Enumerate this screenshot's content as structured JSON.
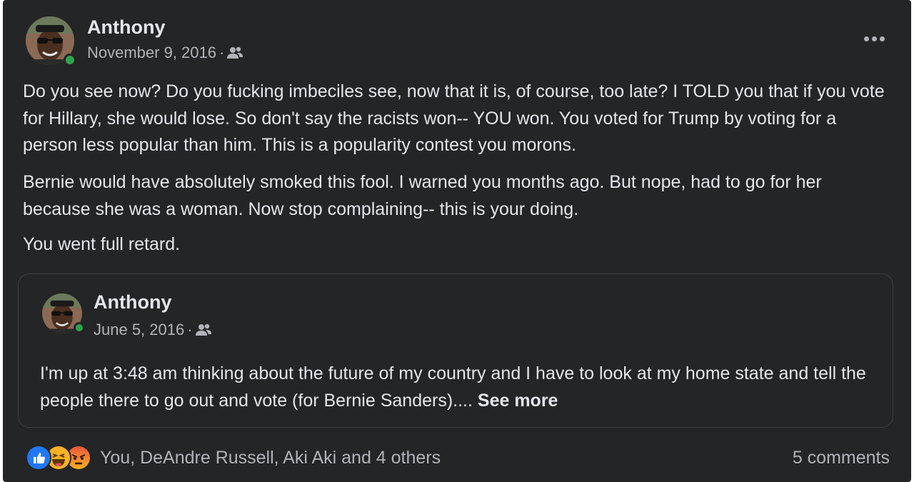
{
  "post": {
    "author": "Anthony",
    "date": "November 9, 2016",
    "separator": "·",
    "audience_icon": "friends-icon",
    "more_icon": "more-options-icon",
    "paragraphs": [
      "Do you see now? Do you fucking imbeciles see, now that it is, of course, too late? I TOLD you that if you vote for Hillary, she would lose. So don't say the racists won-- YOU won. You voted for Trump by voting for a person less popular than him. This is a popularity contest you morons.",
      "Bernie would have absolutely smoked this fool. I warned you months ago.  But nope, had to go for her because she was a woman. Now stop complaining-- this is your doing.",
      "You went full retard."
    ]
  },
  "shared_post": {
    "author": "Anthony",
    "date": "June 5, 2016",
    "separator": "·",
    "audience_icon": "friends-icon",
    "text": "I'm up at 3:48 am thinking about the future of my country and I have to look at my home state and tell the people there to go out and vote (for Bernie Sanders)....",
    "see_more": "See more"
  },
  "footer": {
    "reaction_icons": [
      "like-icon",
      "haha-icon",
      "angry-icon"
    ],
    "reactors": "You, DeAndre Russell, Aki Aki and 4 others",
    "comments": "5 comments"
  },
  "colors": {
    "background": "#242526",
    "text_primary": "#e4e6eb",
    "text_secondary": "#b0b3b8",
    "online": "#31a24c",
    "like": "#2078f4",
    "haha": "#f7b125",
    "angry": "#e9573e"
  }
}
